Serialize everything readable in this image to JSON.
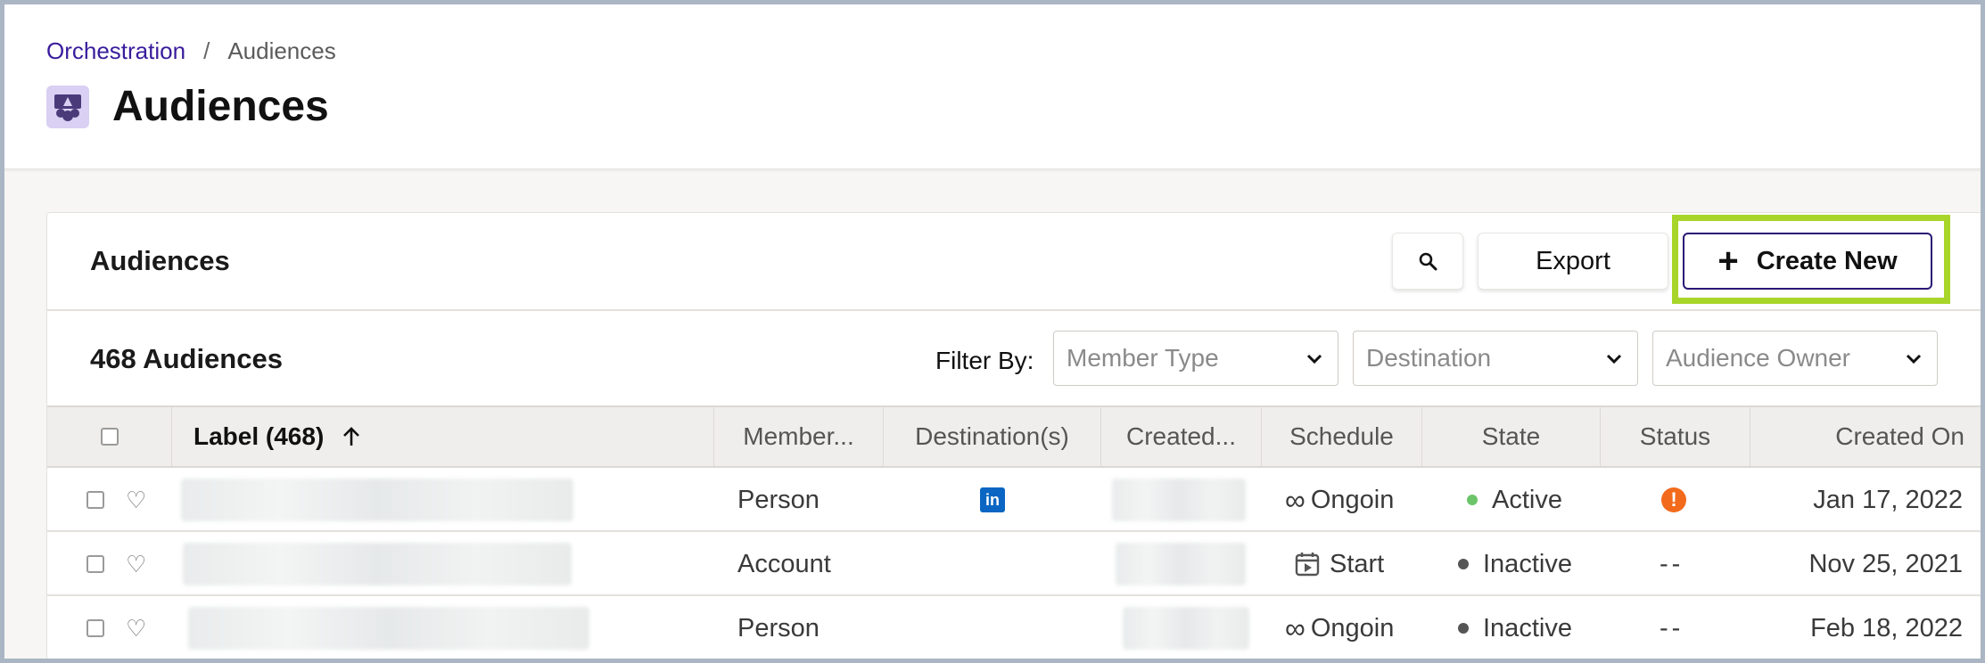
{
  "breadcrumb": {
    "parent": "Orchestration",
    "separator": "/",
    "current": "Audiences"
  },
  "page": {
    "title": "Audiences",
    "icon": "audiences-icon"
  },
  "card": {
    "title": "Audiences",
    "export_label": "Export",
    "create_label": "Create New",
    "count_label": "468 Audiences",
    "filter_label": "Filter By:",
    "filters": [
      {
        "placeholder": "Member Type"
      },
      {
        "placeholder": "Destination"
      },
      {
        "placeholder": "Audience Owner"
      }
    ]
  },
  "table": {
    "columns": {
      "label": "Label (468)",
      "member": "Member...",
      "destinations": "Destination(s)",
      "created_by": "Created...",
      "schedule": "Schedule",
      "state": "State",
      "status": "Status",
      "created_on": "Created On"
    },
    "rows": [
      {
        "member": "Person",
        "destination": "in",
        "schedule_icon": "infinity-icon",
        "schedule": "Ongoin",
        "state": "Active",
        "state_color": "#6cc46a",
        "status": "!",
        "created_on": "Jan 17, 2022"
      },
      {
        "member": "Account",
        "destination": "",
        "schedule_icon": "calendar-icon",
        "schedule": "Start",
        "state": "Inactive",
        "state_color": "#555555",
        "status": "--",
        "created_on": "Nov 25, 2021"
      },
      {
        "member": "Person",
        "destination": "",
        "schedule_icon": "infinity-icon",
        "schedule": "Ongoin",
        "state": "Inactive",
        "state_color": "#555555",
        "status": "--",
        "created_on": "Feb 18, 2022"
      }
    ]
  },
  "colors": {
    "brand": "#3a1c9c",
    "highlight": "#a8d52a",
    "warning": "#f26a1b",
    "linkedin": "#0a66c2"
  }
}
